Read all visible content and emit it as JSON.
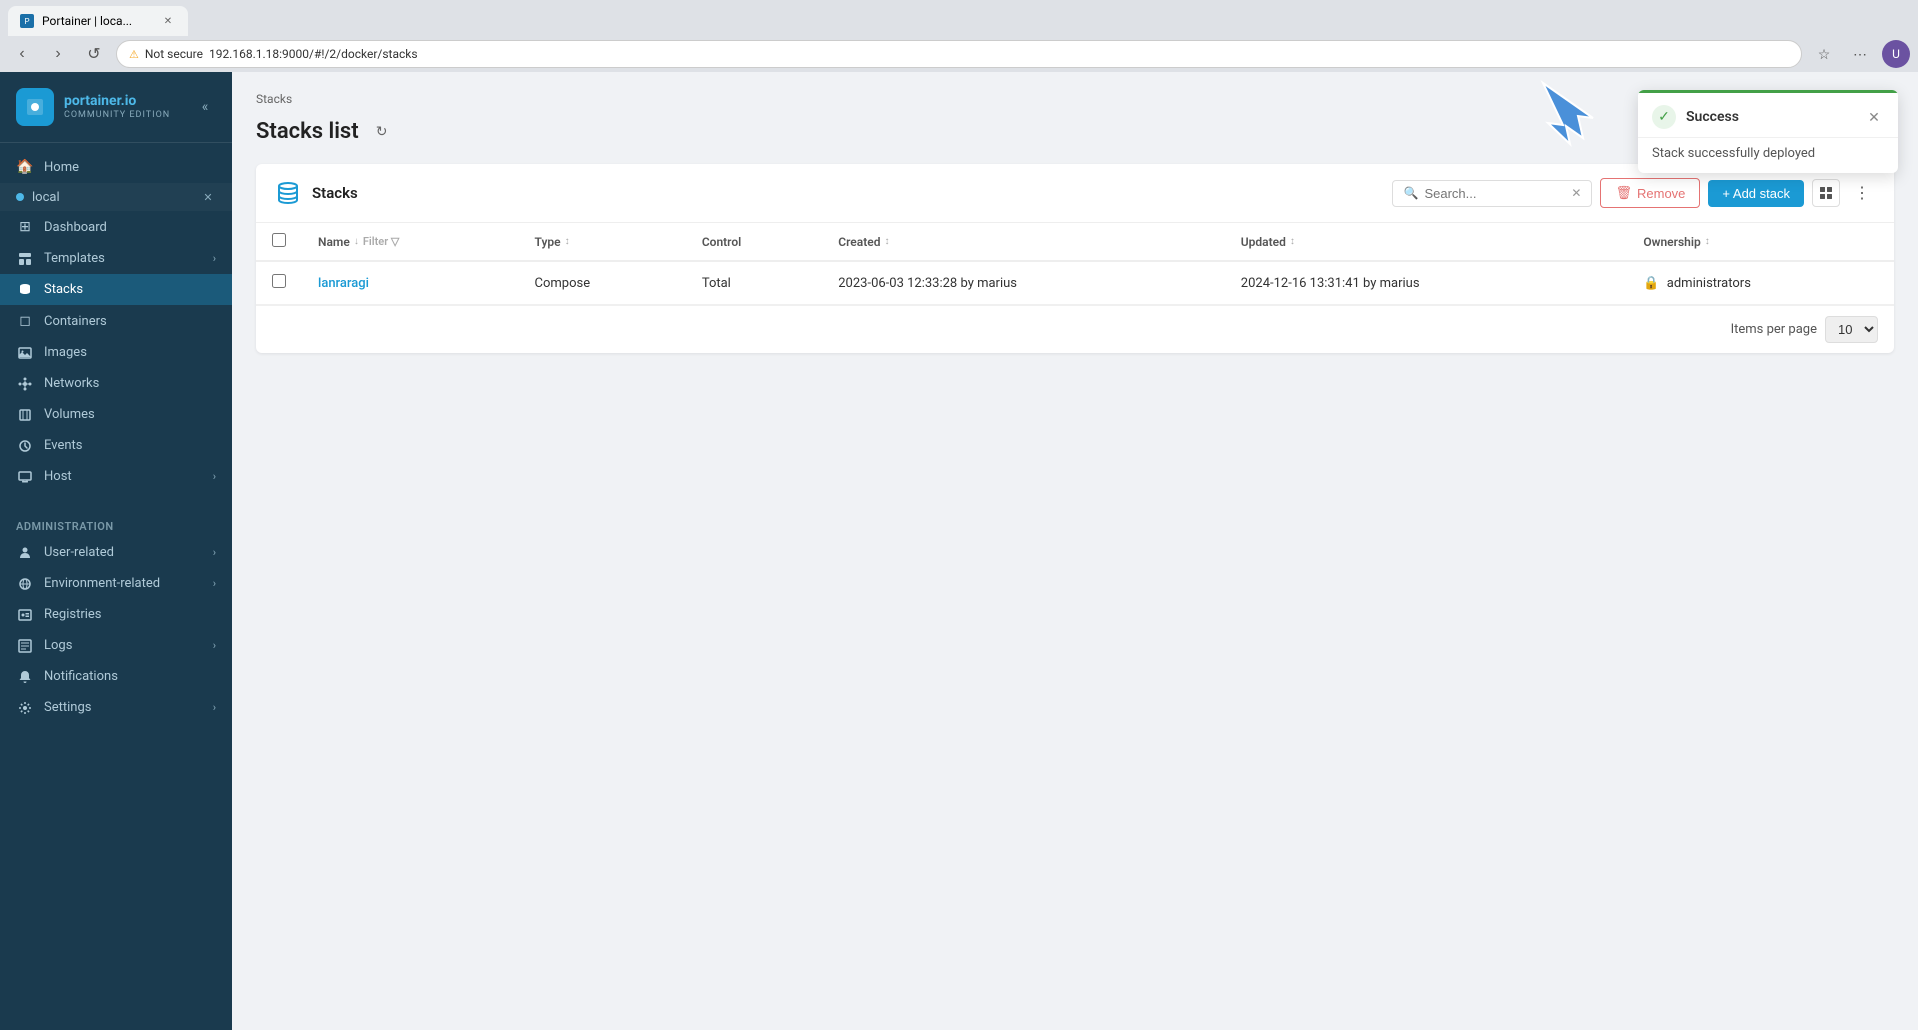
{
  "browser": {
    "tab_title": "Portainer | loca...",
    "url": "192.168.1.18:9000/#!/2/docker/stacks",
    "url_prefix": "Not secure",
    "favicon": "P"
  },
  "sidebar": {
    "logo": {
      "brand": "portainer.io",
      "edition": "COMMUNITY EDITION"
    },
    "env_name": "local",
    "nav_items": [
      {
        "id": "home",
        "label": "Home",
        "icon": "🏠"
      },
      {
        "id": "dashboard",
        "label": "Dashboard",
        "icon": "⊞"
      },
      {
        "id": "templates",
        "label": "Templates",
        "icon": "📋"
      },
      {
        "id": "stacks",
        "label": "Stacks",
        "icon": "⚡"
      },
      {
        "id": "containers",
        "label": "Containers",
        "icon": "◻"
      },
      {
        "id": "images",
        "label": "Images",
        "icon": "🖼"
      },
      {
        "id": "networks",
        "label": "Networks",
        "icon": "🔗"
      },
      {
        "id": "volumes",
        "label": "Volumes",
        "icon": "💾"
      },
      {
        "id": "events",
        "label": "Events",
        "icon": "⏰"
      },
      {
        "id": "host",
        "label": "Host",
        "icon": "🖥"
      }
    ],
    "admin_section": "Administration",
    "admin_items": [
      {
        "id": "user-related",
        "label": "User-related",
        "icon": "👤"
      },
      {
        "id": "environment-related",
        "label": "Environment-related",
        "icon": "🌐"
      },
      {
        "id": "registries",
        "label": "Registries",
        "icon": "📦"
      },
      {
        "id": "logs",
        "label": "Logs",
        "icon": "📊"
      },
      {
        "id": "notifications",
        "label": "Notifications",
        "icon": "🔔"
      },
      {
        "id": "settings",
        "label": "Settings",
        "icon": "⚙"
      }
    ]
  },
  "main": {
    "breadcrumb": "Stacks",
    "page_title": "Stacks list",
    "card": {
      "title": "Stacks",
      "search_placeholder": "Search...",
      "remove_label": "Remove",
      "add_stack_label": "+ Add stack"
    },
    "table": {
      "columns": [
        {
          "id": "name",
          "label": "Name",
          "sort": true,
          "filter": true
        },
        {
          "id": "type",
          "label": "Type",
          "sort": true
        },
        {
          "id": "control",
          "label": "Control"
        },
        {
          "id": "created",
          "label": "Created",
          "sort": true
        },
        {
          "id": "updated",
          "label": "Updated",
          "sort": true
        },
        {
          "id": "ownership",
          "label": "Ownership",
          "sort": true
        }
      ],
      "rows": [
        {
          "name": "lanraragi",
          "type": "Compose",
          "control": "Total",
          "created": "2023-06-03 12:33:28 by marius",
          "updated": "2024-12-16 13:31:41 by marius",
          "ownership": "administrators"
        }
      ]
    },
    "footer": {
      "items_per_page_label": "Items per page",
      "items_per_page_value": "10"
    }
  },
  "notification": {
    "title": "Success",
    "message": "Stack successfully deployed",
    "type": "success"
  }
}
